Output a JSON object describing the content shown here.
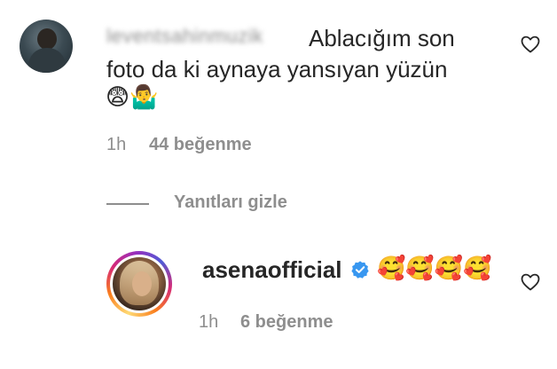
{
  "comment": {
    "username": "leventsahinmuzik",
    "text_line1": "Ablacığım son",
    "text_line2": "foto da ki aynaya yansıyan yüzün",
    "emojis": "😨🤷‍♂️",
    "time": "1h",
    "likes": "44 beğenme"
  },
  "replies_toggle": {
    "label": "Yanıtları gizle"
  },
  "reply": {
    "username": "asenaofficial",
    "emojis": "🥰🥰🥰🥰",
    "time": "1h",
    "likes": "6 beğenme"
  },
  "icons": {
    "like": "heart-outline-icon",
    "verified": "verified-badge-icon"
  },
  "colors": {
    "text": "#262626",
    "secondary": "#8e8e8e",
    "verified": "#3897f0"
  }
}
